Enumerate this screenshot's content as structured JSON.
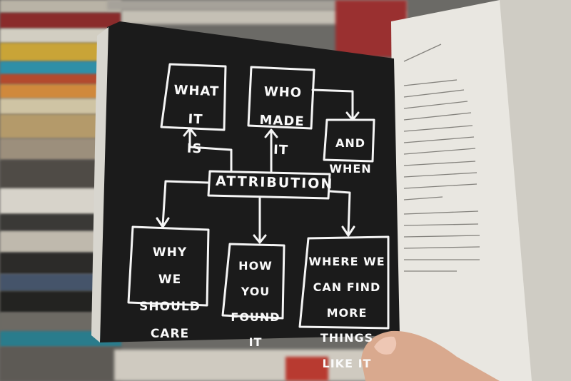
{
  "diagram": {
    "center": "ATTRIBUTION",
    "boxes": {
      "what_it_is": [
        "WHAT",
        "IT",
        "IS"
      ],
      "who_made_it": [
        "WHO",
        "MADE",
        "IT"
      ],
      "and_when": [
        "AND",
        "WHEN"
      ],
      "why_we_should_care": [
        "WHY",
        "WE",
        "SHOULD",
        "CARE"
      ],
      "how_you_found_it": [
        "HOW",
        "YOU",
        "FOUND",
        "IT"
      ],
      "where_we_can_find": [
        "WHERE WE",
        "CAN FIND",
        "MORE",
        "THINGS",
        "LIKE IT"
      ]
    }
  },
  "colors": {
    "page_black": "#1b1b1b",
    "chalk_white": "#f5f5f5",
    "paper": "#e9e7e1",
    "skin": "#d9a98e"
  }
}
